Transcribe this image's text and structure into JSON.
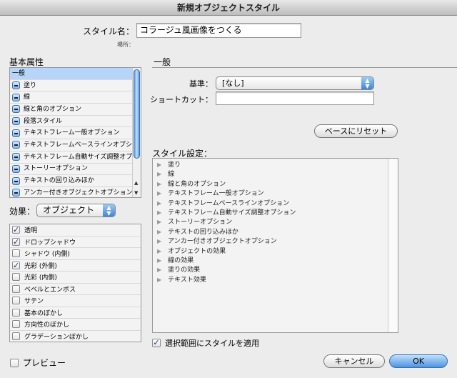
{
  "window": {
    "title": "新規オブジェクトスタイル"
  },
  "style_name": {
    "label": "スタイル名：",
    "value": "コラージュ風画像をつくる"
  },
  "location": {
    "label": "場所："
  },
  "basic_attributes": {
    "heading": "基本属性",
    "items": [
      {
        "label": "一般",
        "selected": true,
        "icon": "none"
      },
      {
        "label": "塗り",
        "icon": "minus-icon"
      },
      {
        "label": "線",
        "icon": "minus-icon"
      },
      {
        "label": "線と角のオプション",
        "icon": "minus-icon"
      },
      {
        "label": "段落スタイル",
        "icon": "minus-icon"
      },
      {
        "label": "テキストフレーム一般オプション",
        "icon": "minus-icon"
      },
      {
        "label": "テキストフレームベースラインオプション",
        "icon": "minus-icon"
      },
      {
        "label": "テキストフレーム自動サイズ調整オプショ",
        "icon": "minus-icon"
      },
      {
        "label": "ストーリーオプション",
        "icon": "minus-icon"
      },
      {
        "label": "テキストの回り込みほか",
        "icon": "minus-icon"
      },
      {
        "label": "アンカー付きオブジェクトオプション",
        "icon": "minus-icon"
      }
    ]
  },
  "effects": {
    "label": "効果：",
    "selected": "オブジェクト",
    "items": [
      {
        "label": "透明",
        "checked": true
      },
      {
        "label": "ドロップシャドウ",
        "checked": true
      },
      {
        "label": "シャドウ (内側)",
        "checked": false
      },
      {
        "label": "光彩 (外側)",
        "checked": true
      },
      {
        "label": "光彩 (内側)",
        "checked": false
      },
      {
        "label": "ベベルとエンボス",
        "checked": false
      },
      {
        "label": "サテン",
        "checked": false
      },
      {
        "label": "基本のぼかし",
        "checked": false
      },
      {
        "label": "方向性のぼかし",
        "checked": false
      },
      {
        "label": "グラデーションぼかし",
        "checked": false
      }
    ]
  },
  "preview": {
    "label": "プレビュー",
    "checked": false
  },
  "general": {
    "heading": "一般",
    "base_label": "基準：",
    "base_value": "[なし]",
    "shortcut_label": "ショートカット：",
    "shortcut_value": "",
    "reset_button": "ベースにリセット"
  },
  "style_settings": {
    "heading": "スタイル設定：",
    "items": [
      "塗り",
      "線",
      "線と角のオプション",
      "テキストフレーム一般オプション",
      "テキストフレームベースラインオプション",
      "テキストフレーム自動サイズ調整オプション",
      "ストーリーオプション",
      "テキストの回り込みほか",
      "アンカー付きオブジェクトオプション",
      "オブジェクトの効果",
      "線の効果",
      "塗りの効果",
      "テキスト効果"
    ]
  },
  "apply_to_selection": {
    "label": "選択範囲にスタイルを適用",
    "checked": true
  },
  "buttons": {
    "cancel": "キャンセル",
    "ok": "OK"
  }
}
